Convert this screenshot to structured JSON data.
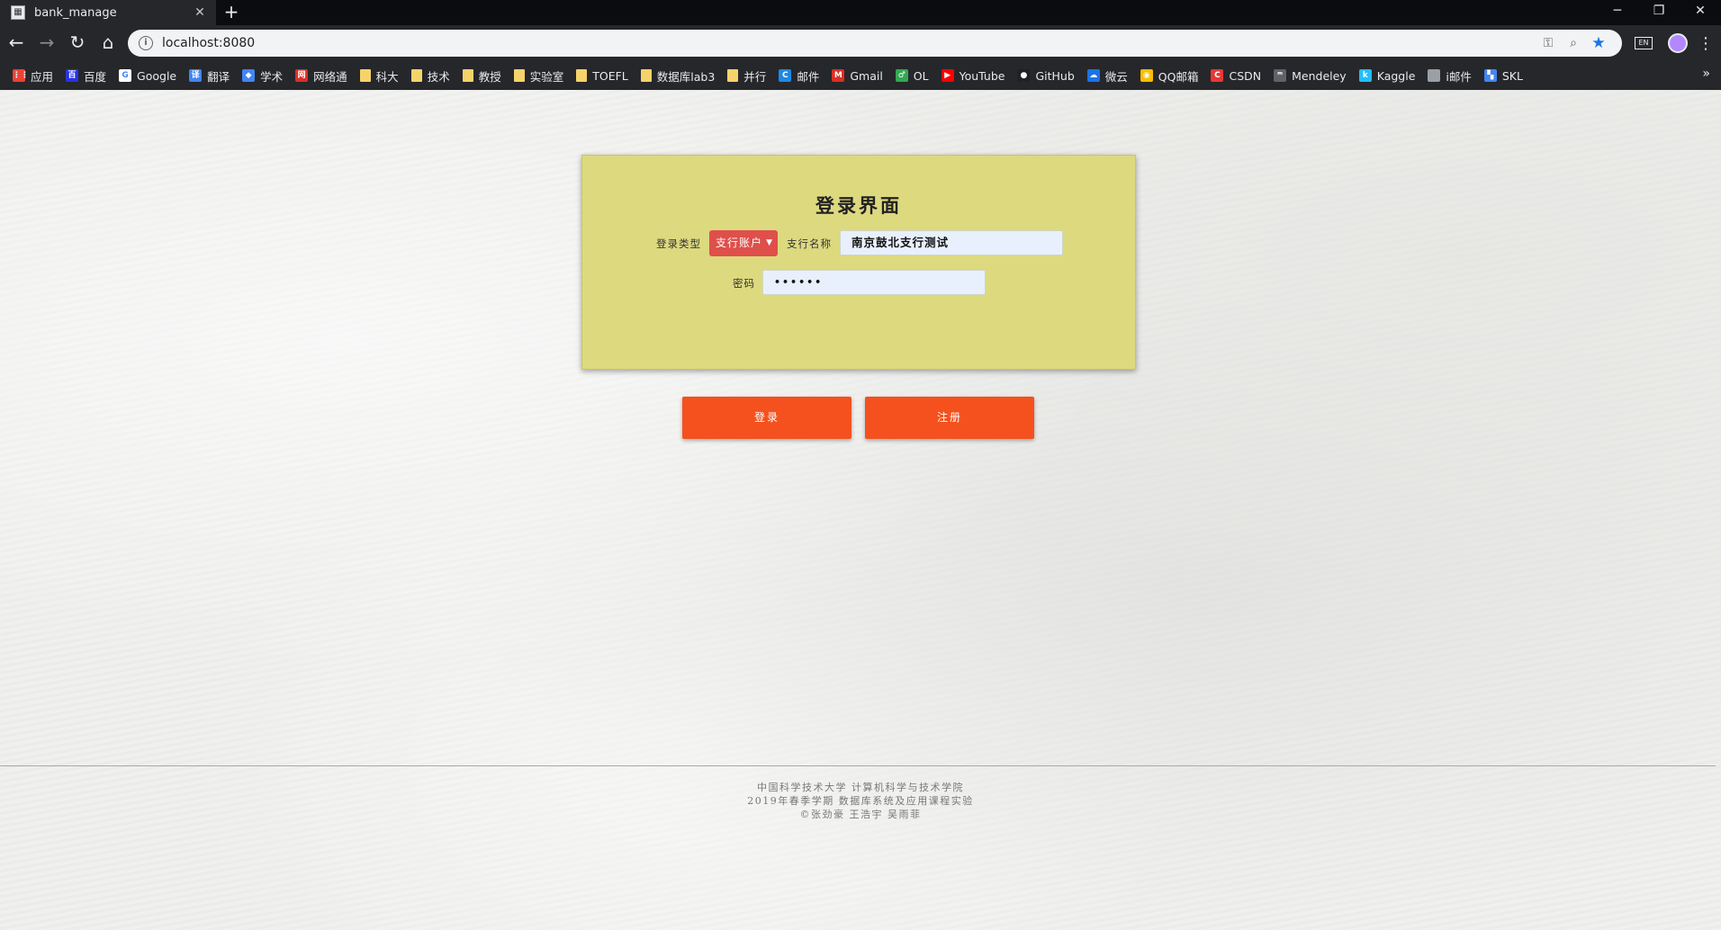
{
  "browser": {
    "tab_title": "bank_manage",
    "tab_favicon": "bank-favicon",
    "url": "localhost:8080",
    "bookmarks": [
      {
        "label": "应用",
        "icon": "apps-grid-icon",
        "color": "#ea4335"
      },
      {
        "label": "百度",
        "icon": "baidu-icon",
        "color": "#2932e1"
      },
      {
        "label": "Google",
        "icon": "google-icon",
        "color": "#ffffff"
      },
      {
        "label": "翻译",
        "icon": "translate-icon",
        "color": "#4285f4"
      },
      {
        "label": "学术",
        "icon": "scholar-icon",
        "color": "#4285f4"
      },
      {
        "label": "网络通",
        "icon": "network-icon",
        "color": "#d93025"
      },
      {
        "label": "科大",
        "icon": "folder-icon",
        "color": "#f6d36a"
      },
      {
        "label": "技术",
        "icon": "folder-icon",
        "color": "#f6d36a"
      },
      {
        "label": "教授",
        "icon": "folder-icon",
        "color": "#f6d36a"
      },
      {
        "label": "实验室",
        "icon": "folder-icon",
        "color": "#f6d36a"
      },
      {
        "label": "TOEFL",
        "icon": "folder-icon",
        "color": "#f6d36a"
      },
      {
        "label": "数据库lab3",
        "icon": "folder-icon",
        "color": "#f6d36a"
      },
      {
        "label": "并行",
        "icon": "folder-icon",
        "color": "#f6d36a"
      },
      {
        "label": "邮件",
        "icon": "mail-icon",
        "color": "#1e88e5"
      },
      {
        "label": "Gmail",
        "icon": "gmail-icon",
        "color": "#d93025"
      },
      {
        "label": "OL",
        "icon": "ol-icon",
        "color": "#34a853"
      },
      {
        "label": "YouTube",
        "icon": "youtube-icon",
        "color": "#ff0000"
      },
      {
        "label": "GitHub",
        "icon": "github-icon",
        "color": "#202124"
      },
      {
        "label": "微云",
        "icon": "weiyun-icon",
        "color": "#1a73e8"
      },
      {
        "label": "QQ邮箱",
        "icon": "qqmail-icon",
        "color": "#fbbc04"
      },
      {
        "label": "CSDN",
        "icon": "csdn-icon",
        "color": "#e53935"
      },
      {
        "label": "Mendeley",
        "icon": "mendeley-icon",
        "color": "#5f6368"
      },
      {
        "label": "Kaggle",
        "icon": "kaggle-icon",
        "color": "#20beff"
      },
      {
        "label": "i邮件",
        "icon": "apple-icon",
        "color": "#9aa0a6"
      },
      {
        "label": "SKL",
        "icon": "skl-icon",
        "color": "#4285f4"
      }
    ]
  },
  "login": {
    "title": "登录界面",
    "type_label": "登录类型",
    "type_value": "支行账户",
    "branch_label": "支行名称",
    "branch_value": "南京鼓北支行测试",
    "password_label": "密码",
    "password_value": "••••••",
    "login_button": "登录",
    "register_button": "注册"
  },
  "footer": {
    "line1": "中国科学技术大学  计算机科学与技术学院",
    "line2": "2019年春季学期  数据库系统及应用课程实验",
    "line3": "©张劲豪  王浩宇  吴雨菲"
  },
  "colors": {
    "card_bg": "#ddd97f",
    "select_bg": "#df4f4b",
    "button_bg": "#f4511e",
    "input_bg": "#e8f0fe"
  }
}
